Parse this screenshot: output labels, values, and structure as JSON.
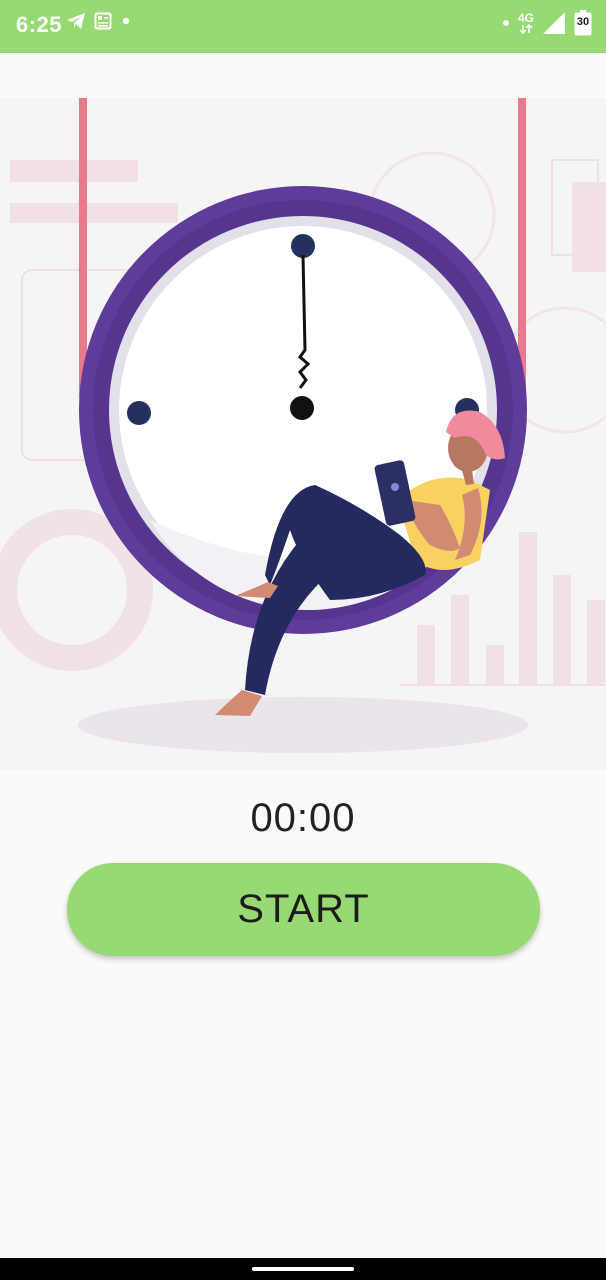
{
  "status_bar": {
    "time": "6:25",
    "network_type": "4G",
    "battery_level": "30",
    "icons": [
      "telegram-icon",
      "news-icon",
      "notification-dot-icon",
      "dot-icon",
      "data-arrows-icon",
      "signal-icon",
      "battery-icon"
    ]
  },
  "illustration": {
    "subject": "woman-reading-in-clock-swing",
    "colors": {
      "clock_ring": "#5f3c99",
      "clock_face": "#ffffff",
      "hands": "#111111",
      "markers": "#24305e",
      "pants": "#24295f",
      "shirt": "#f8d160",
      "hair": "#ef8b9c",
      "ropes": "#e87a8c",
      "background": "#f5f4f7"
    }
  },
  "timer": {
    "display": "00:00"
  },
  "controls": {
    "start_label": "START"
  },
  "theme": {
    "accent": "#97d972",
    "background": "#fafafa",
    "text": "#222222"
  }
}
